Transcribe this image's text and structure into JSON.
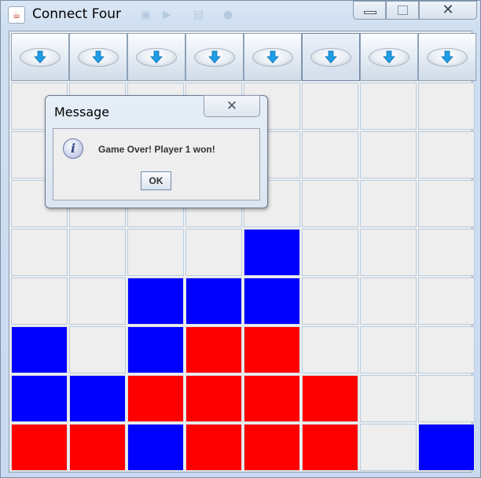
{
  "window": {
    "title": "Connect Four",
    "app_icon": "java-cup-icon",
    "controls": [
      "minimize-icon",
      "maximize-icon",
      "close-icon"
    ]
  },
  "board": {
    "columns": 8,
    "rows": 8,
    "drop_button_icon": "down-arrow-icon",
    "active_drop_column": 5,
    "colors": {
      "red": "#ff0000",
      "blue": "#0000ff",
      "empty": "#eeeeee"
    },
    "cells": [
      [
        "",
        "",
        "",
        "",
        "",
        "",
        "",
        ""
      ],
      [
        "",
        "",
        "",
        "",
        "",
        "",
        "",
        ""
      ],
      [
        "",
        "",
        "",
        "",
        "",
        "",
        "",
        ""
      ],
      [
        "",
        "",
        "",
        "",
        "blue",
        "",
        "",
        ""
      ],
      [
        "",
        "",
        "blue",
        "blue",
        "blue",
        "",
        "",
        ""
      ],
      [
        "blue",
        "",
        "blue",
        "red",
        "red",
        "",
        "",
        ""
      ],
      [
        "blue",
        "blue",
        "red",
        "red",
        "red",
        "red",
        "",
        ""
      ],
      [
        "red",
        "red",
        "blue",
        "red",
        "red",
        "red",
        "",
        "blue"
      ]
    ]
  },
  "dialog": {
    "title": "Message",
    "icon": "information-icon",
    "message": "Game Over! Player 1 won!",
    "ok_label": "OK"
  }
}
